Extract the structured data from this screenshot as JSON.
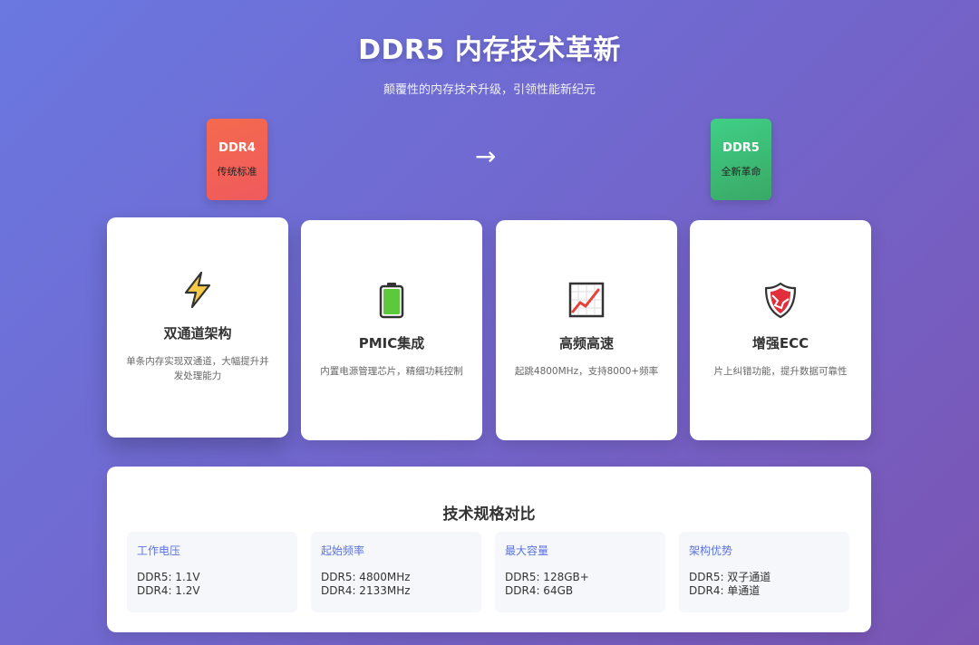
{
  "header": {
    "title": "DDR5 内存技术革新",
    "subtitle": "颠覆性的内存技术升级，引领性能新纪元"
  },
  "compare": {
    "ddr4": {
      "name": "DDR4",
      "desc": "传统标准",
      "color": "#f46a4e"
    },
    "arrow": "→",
    "ddr5": {
      "name": "DDR5",
      "desc": "全新革命",
      "color": "#3fcf86"
    }
  },
  "features": [
    {
      "icon": "lightning-icon",
      "title": "双通道架构",
      "desc": "单条内存实现双通道，大幅提升并发处理能力"
    },
    {
      "icon": "battery-icon",
      "title": "PMIC集成",
      "desc": "内置电源管理芯片，精细功耗控制"
    },
    {
      "icon": "chart-icon",
      "title": "高频高速",
      "desc": "起跳4800MHz，支持8000+频率"
    },
    {
      "icon": "shield-icon",
      "title": "增强ECC",
      "desc": "片上纠错功能，提升数据可靠性"
    }
  ],
  "specs": {
    "title": "技术规格对比",
    "items": [
      {
        "label": "工作电压",
        "ddr5": "DDR5: 1.1V",
        "ddr4": "DDR4: 1.2V"
      },
      {
        "label": "起始频率",
        "ddr5": "DDR5: 4800MHz",
        "ddr4": "DDR4: 2133MHz"
      },
      {
        "label": "最大容量",
        "ddr5": "DDR5: 128GB+",
        "ddr4": "DDR4: 64GB"
      },
      {
        "label": "架构优势",
        "ddr5": "DDR5: 双子通道",
        "ddr4": "DDR4: 单通道"
      }
    ]
  },
  "colors": {
    "accent": "#5a72e0",
    "bg_start": "#6a78e0",
    "bg_end": "#7a55b4"
  }
}
